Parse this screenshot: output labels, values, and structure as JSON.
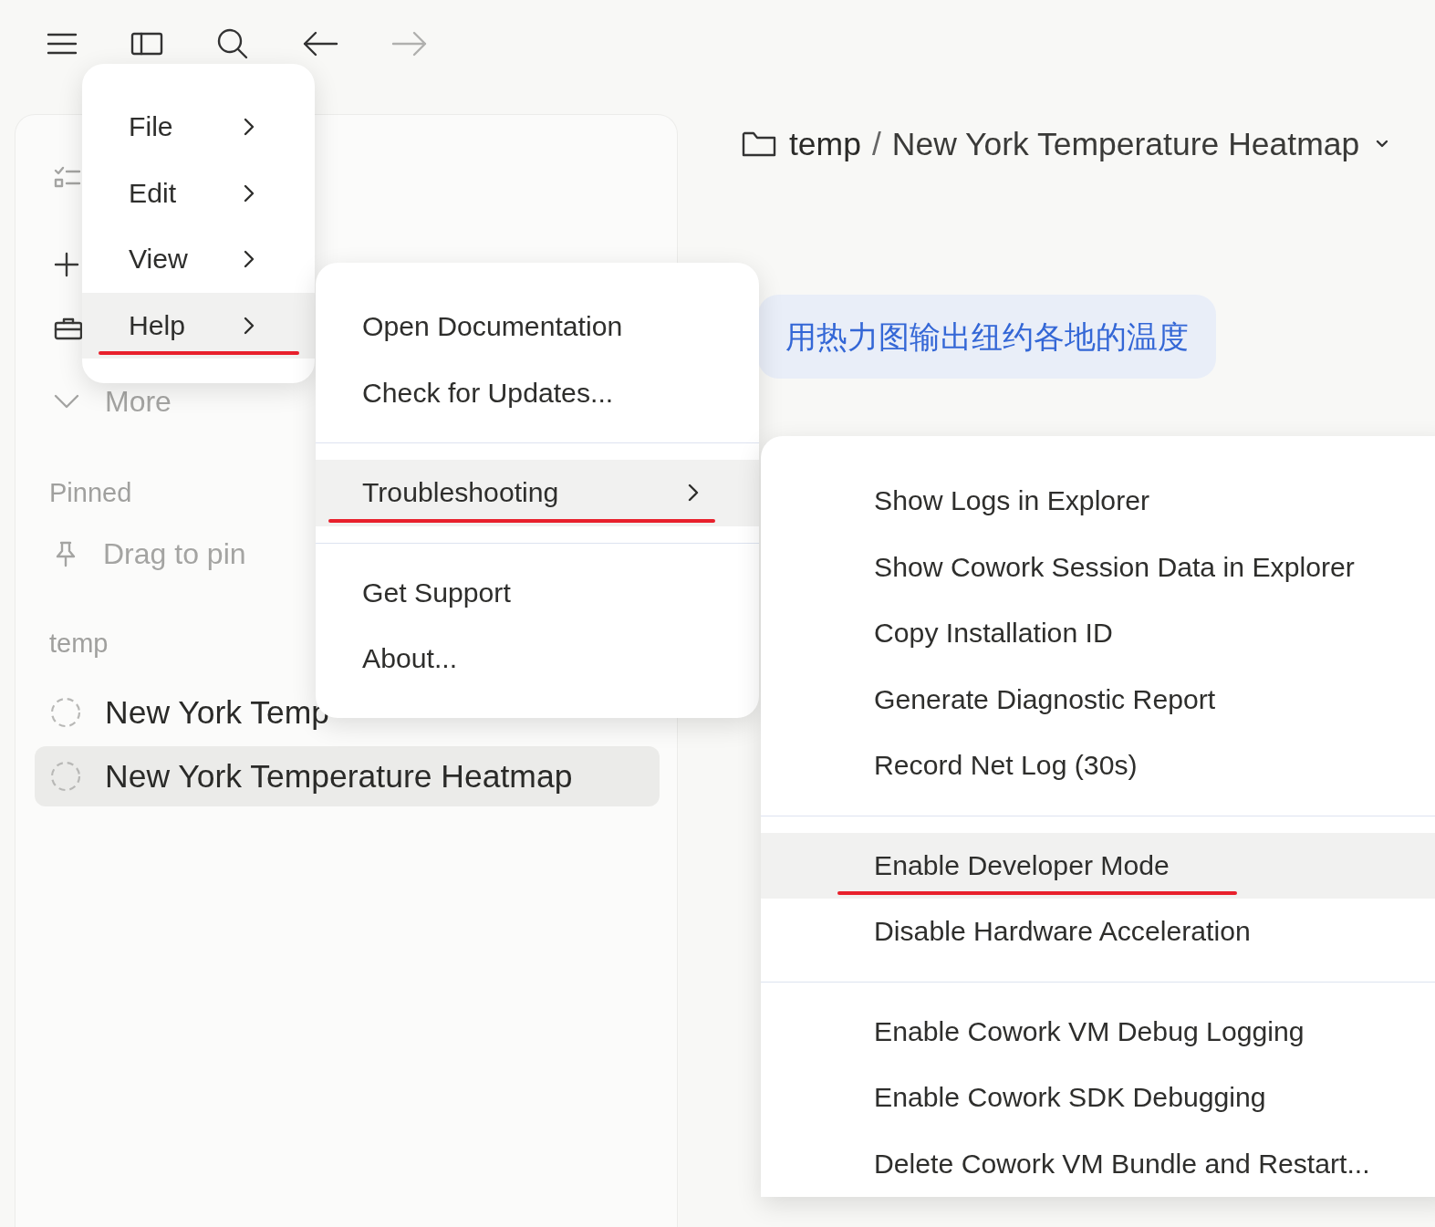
{
  "toolbar": {
    "forward_disabled": true
  },
  "sidebar": {
    "more_label": "More",
    "pinned_label": "Pinned",
    "pin_hint": "Drag to pin",
    "group_label": "temp",
    "items": [
      {
        "label": "New York Temp",
        "selected": false
      },
      {
        "label": "New York Temperature Heatmap",
        "selected": true
      }
    ]
  },
  "breadcrumb": {
    "folder": "temp",
    "separator": "/",
    "title": "New York Temperature Heatmap"
  },
  "message": "用热力图输出纽约各地的温度",
  "menus": [
    {
      "groups": [
        [
          {
            "label": "File",
            "submenu": true,
            "selected": false,
            "underlined": false
          },
          {
            "label": "Edit",
            "submenu": true,
            "selected": false,
            "underlined": false
          },
          {
            "label": "View",
            "submenu": true,
            "selected": false,
            "underlined": false
          },
          {
            "label": "Help",
            "submenu": true,
            "selected": true,
            "underlined": true
          }
        ]
      ]
    },
    {
      "groups": [
        [
          {
            "label": "Open Documentation",
            "submenu": false,
            "selected": false,
            "underlined": false
          },
          {
            "label": "Check for Updates...",
            "submenu": false,
            "selected": false,
            "underlined": false
          }
        ],
        [
          {
            "label": "Troubleshooting",
            "submenu": true,
            "selected": true,
            "underlined": true
          }
        ],
        [
          {
            "label": "Get Support",
            "submenu": false,
            "selected": false,
            "underlined": false
          },
          {
            "label": "About...",
            "submenu": false,
            "selected": false,
            "underlined": false
          }
        ]
      ]
    },
    {
      "groups": [
        [
          {
            "label": "Show Logs in Explorer",
            "submenu": false,
            "selected": false,
            "underlined": false
          },
          {
            "label": "Show Cowork Session Data in Explorer",
            "submenu": false,
            "selected": false,
            "underlined": false
          },
          {
            "label": "Copy Installation ID",
            "submenu": false,
            "selected": false,
            "underlined": false
          },
          {
            "label": "Generate Diagnostic Report",
            "submenu": false,
            "selected": false,
            "underlined": false
          },
          {
            "label": "Record Net Log (30s)",
            "submenu": false,
            "selected": false,
            "underlined": false
          }
        ],
        [
          {
            "label": "Enable Developer Mode",
            "submenu": false,
            "selected": true,
            "underlined": true
          },
          {
            "label": "Disable Hardware Acceleration",
            "submenu": false,
            "selected": false,
            "underlined": false
          }
        ],
        [
          {
            "label": "Enable Cowork VM Debug Logging",
            "submenu": false,
            "selected": false,
            "underlined": false
          },
          {
            "label": "Enable Cowork SDK Debugging",
            "submenu": false,
            "selected": false,
            "underlined": false
          },
          {
            "label": "Delete Cowork VM Bundle and Restart...",
            "submenu": false,
            "selected": false,
            "underlined": false
          }
        ]
      ]
    }
  ]
}
